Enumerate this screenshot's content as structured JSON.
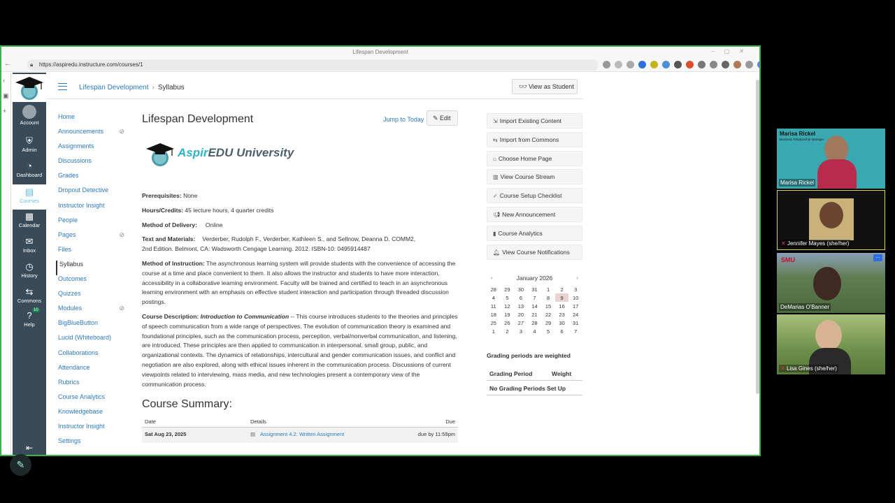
{
  "browser": {
    "window_title": "Lifespan Development",
    "url": "https://aspiredu.instructure.com/courses/1"
  },
  "global_nav": [
    {
      "label": "Account",
      "icon": "account-icon"
    },
    {
      "label": "Admin",
      "icon": "shield-icon"
    },
    {
      "label": "Dashboard",
      "icon": "dashboard-icon"
    },
    {
      "label": "Courses",
      "icon": "book-icon"
    },
    {
      "label": "Calendar",
      "icon": "calendar-icon"
    },
    {
      "label": "Inbox",
      "icon": "inbox-icon"
    },
    {
      "label": "History",
      "icon": "clock-icon"
    },
    {
      "label": "Commons",
      "icon": "commons-icon"
    },
    {
      "label": "Help",
      "icon": "help-icon",
      "badge": "10"
    }
  ],
  "breadcrumb": {
    "course": "Lifespan Development",
    "page": "Syllabus"
  },
  "view_as_student": "View as Student",
  "course_nav": [
    {
      "label": "Home"
    },
    {
      "label": "Announcements",
      "hidden": true
    },
    {
      "label": "Assignments"
    },
    {
      "label": "Discussions"
    },
    {
      "label": "Grades"
    },
    {
      "label": "Dropout Detective"
    },
    {
      "label": "Instructor Insight"
    },
    {
      "label": "People"
    },
    {
      "label": "Pages",
      "hidden": true
    },
    {
      "label": "Files"
    },
    {
      "label": "Syllabus",
      "active": true
    },
    {
      "label": "Outcomes"
    },
    {
      "label": "Quizzes"
    },
    {
      "label": "Modules",
      "hidden": true
    },
    {
      "label": "BigBlueButton"
    },
    {
      "label": "Lucid (Whiteboard)"
    },
    {
      "label": "Collaborations"
    },
    {
      "label": "Attendance"
    },
    {
      "label": "Rubrics"
    },
    {
      "label": "Course Analytics"
    },
    {
      "label": "Knowledgebase"
    },
    {
      "label": "Instructor Insight"
    },
    {
      "label": "Settings"
    }
  ],
  "main": {
    "title": "Lifespan Development",
    "jump_to_today": "Jump to Today",
    "edit": "Edit",
    "university_logo": {
      "part1": "Aspir",
      "part2": "EDU University"
    },
    "prereq_label": "Prerequisites:",
    "prereq_value": " None",
    "hours_label": "Hours/Credits:",
    "hours_value": " 45 lecture hours, 4 quarter credits",
    "delivery_label": "Method of Delivery:",
    "delivery_value": "Online",
    "materials_label": "Text and Materials:",
    "materials_value_1": "Verderber, Rudolph F., Verderber, Kathleen S., and Sellnow, Deanna D. COMM2,",
    "materials_value_2": "2nd Edition. Belmont, CA: Wadsworth Cengage Learning. 2012. ISBN-10: 0495914487",
    "instruction_label": "Method of Instruction:",
    "instruction_value": " The asynchronous learning system will provide students with the convenience of accessing the course at a time and place convenient to them. It also allows the instructor and students to have more interaction, accessibility in a collaborative learning environment.  Faculty will be trained and certified to teach in an asynchronous learning environment with an emphasis on effective student interaction and participation through threaded discussion postings.",
    "description_label": "Course Description:",
    "description_title": "Introduction to Communication",
    "description_value": " -- This course introduces students to the theories and principles of speech communication from a wide range of perspectives. The evolution of communication theory is examined and foundational principles, such as the communication process, perception, verbal/nonverbal communication, and listening, are introduced. These principles are then applied to communication in interpersonal, small group, public, and organizational contexts. The dynamics of relationships, intercultural and gender communication issues, and conflict and negotiation are also explored, along with ethical issues inherent in the communication process. Discussions of current viewpoints related to interviewing, mass media, and new technologies present a contemporary view of the communication process.",
    "summary_heading": "Course Summary:",
    "summary_cols": {
      "date": "Date",
      "details": "Details",
      "due": "Due"
    },
    "summary_rows": [
      {
        "date": "Sat Aug 23, 2025",
        "details": "Assignment 4.2: Written Assignment",
        "due": "due by 11:59pm"
      }
    ]
  },
  "sidebar_buttons": [
    {
      "label": "Import Existing Content",
      "icon": "import-icon"
    },
    {
      "label": "Import from Commons",
      "icon": "commons-icon"
    },
    {
      "label": "Choose Home Page",
      "icon": "home-icon"
    },
    {
      "label": "View Course Stream",
      "icon": "stream-icon"
    },
    {
      "label": "Course Setup Checklist",
      "icon": "checklist-icon"
    },
    {
      "label": "New Announcement",
      "icon": "megaphone-icon"
    },
    {
      "label": "Course Analytics",
      "icon": "analytics-icon"
    },
    {
      "label": "View Course Notifications",
      "icon": "bell-icon"
    }
  ],
  "calendar": {
    "month": "January 2026",
    "today": "9",
    "weeks": [
      [
        "28",
        "29",
        "30",
        "31",
        "1",
        "2",
        "3"
      ],
      [
        "4",
        "5",
        "6",
        "7",
        "8",
        "9",
        "10"
      ],
      [
        "11",
        "12",
        "13",
        "14",
        "15",
        "16",
        "17"
      ],
      [
        "18",
        "19",
        "20",
        "21",
        "22",
        "23",
        "24"
      ],
      [
        "25",
        "26",
        "27",
        "28",
        "29",
        "30",
        "31"
      ],
      [
        "1",
        "2",
        "3",
        "4",
        "5",
        "6",
        "7"
      ]
    ]
  },
  "grading": {
    "heading": "Grading periods are weighted",
    "col_period": "Grading Period",
    "col_weight": "Weight",
    "empty": "No Grading Periods Set Up"
  },
  "participants": [
    {
      "name": "Marisa Rickel",
      "title_line": "Marisa Rickel",
      "subtitle": "Business Relationship Manager",
      "bg": "#3aa8b0"
    },
    {
      "name": "Jennifer Mayes (she/her)",
      "bg": "#1a1a1a"
    },
    {
      "name": "DeMarias O'Banner",
      "tag": "SMU",
      "bg": "#5f7d52"
    },
    {
      "name": "Lisa Gines (she/her)",
      "bg": "#6c8f4a"
    }
  ],
  "colors": {
    "accent": "#2b7abc",
    "nav": "#394b58",
    "window_border": "#3bb54a"
  }
}
